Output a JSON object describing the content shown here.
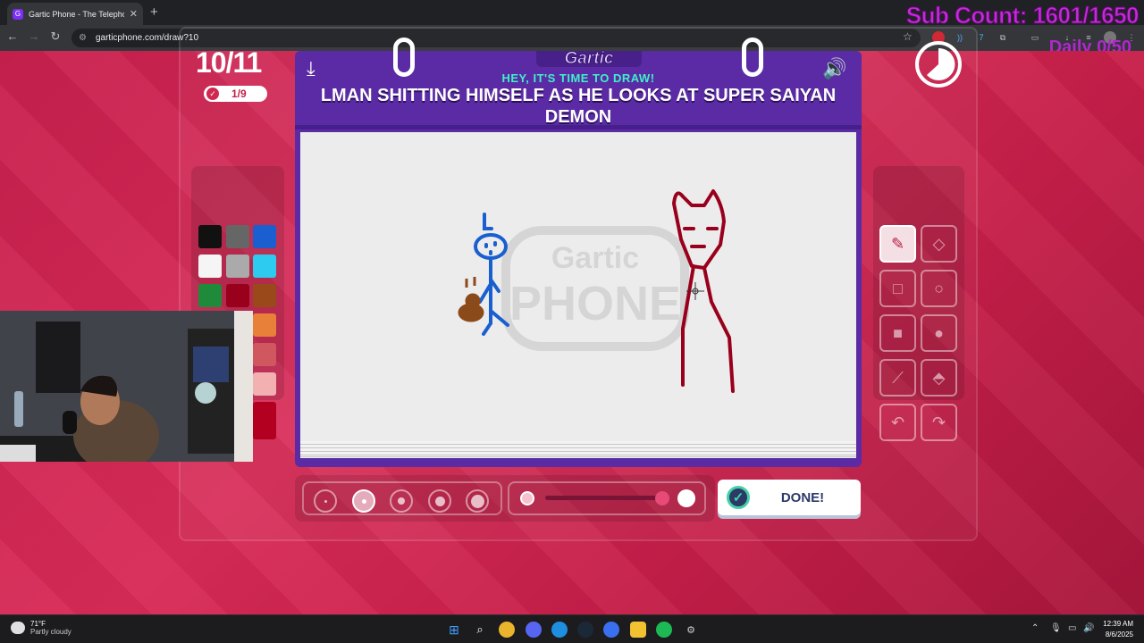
{
  "browser": {
    "tab_title": "Gartic Phone - The Telephone G",
    "tab_close": "✕",
    "new_tab": "+",
    "url": "garticphone.com/draw?10",
    "back": "←",
    "forward": "→",
    "reload": "↻",
    "star": "☆"
  },
  "stream_overlay": {
    "sub_count": "Sub Count: 1601/1650",
    "daily": "Daily 0/50"
  },
  "game": {
    "round": "10/11",
    "done_progress": "1/9",
    "brand": "Gartic",
    "prompt_header": "HEY, IT'S TIME TO DRAW!",
    "prompt": "LMAN SHITTING HIMSELF AS HE LOOKS AT SUPER SAIYAN DEMON",
    "done_label": "DONE!",
    "palette": [
      "#111111",
      "#666666",
      "#1a5fd0",
      "#f5f5f5",
      "#aaaaaa",
      "#2ecbf0",
      "#1f8b3a",
      "#99001c",
      "#9a4a1a",
      "#e8803a",
      "#d0575f",
      "#f2b0b0",
      "#b40020"
    ],
    "canvas_watermark": "Gartic PHONE"
  },
  "taskbar": {
    "weather_temp": "71°F",
    "weather_desc": "Partly cloudy",
    "time": "12:39 AM",
    "date": "8/6/2025"
  }
}
